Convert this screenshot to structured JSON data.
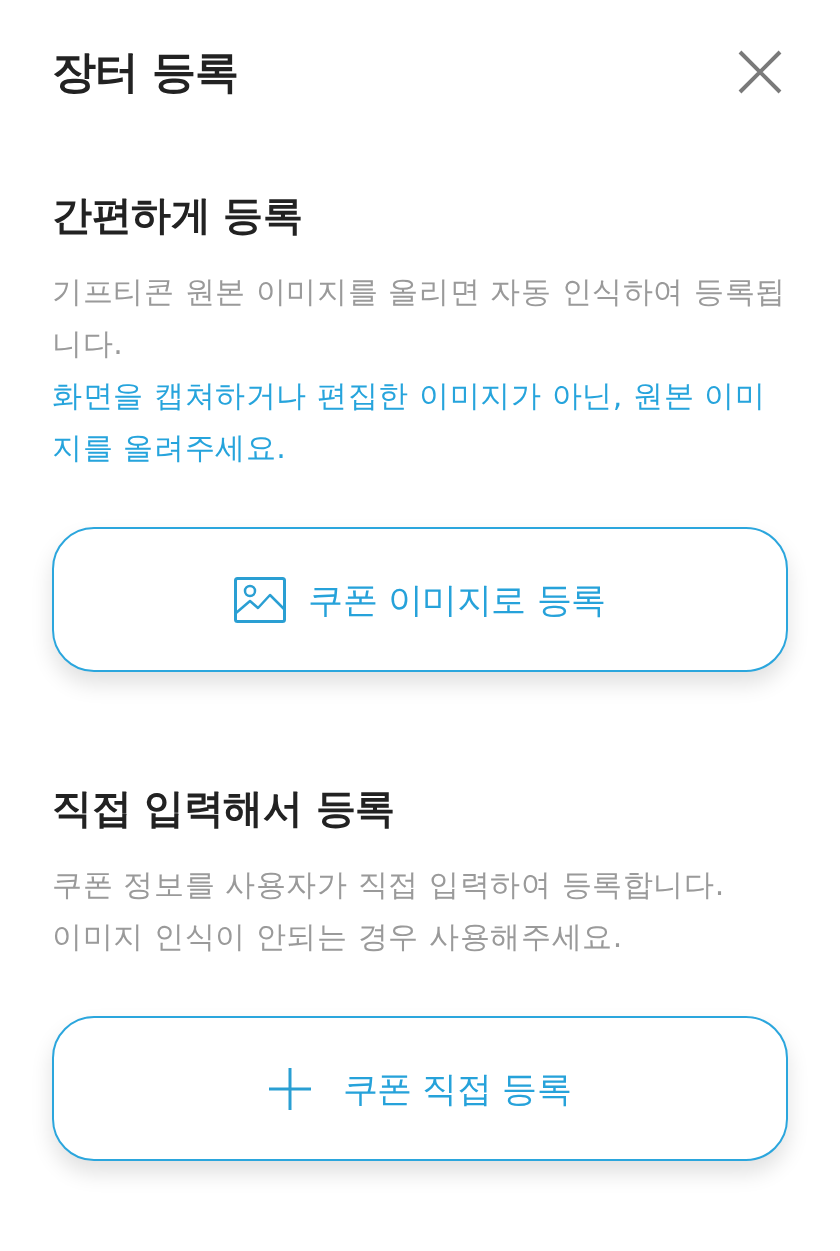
{
  "header": {
    "title": "장터 등록"
  },
  "sections": [
    {
      "heading": "간편하게 등록",
      "description": [
        {
          "text": "기프티콘 원본 이미지를 올리면 자동 인식하여 등록됩니다.",
          "kind": "info"
        },
        {
          "text": "화면을 캡쳐하거나 편집한 이미지가 아닌, 원본 이미지를 올려주세요.",
          "kind": "notice"
        }
      ],
      "button": {
        "label": "쿠폰 이미지로 등록",
        "kind": "image"
      }
    },
    {
      "heading": "직접 입력해서 등록",
      "description": [
        {
          "text": "쿠폰 정보를 사용자가 직접 입력하여 등록합니다.",
          "kind": "info"
        },
        {
          "text": "이미지 인식이 안되는 경우 사용해주세요.",
          "kind": "info"
        }
      ],
      "button": {
        "label": "쿠폰 직접 등록",
        "kind": "manual"
      }
    }
  ]
}
